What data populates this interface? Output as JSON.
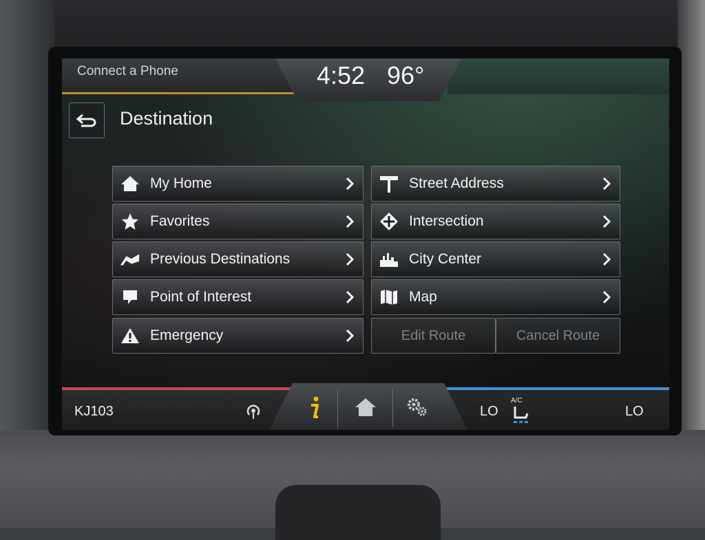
{
  "status": {
    "phone_label": "Connect a Phone",
    "time": "4:52",
    "temperature": "96°"
  },
  "header": {
    "title": "Destination"
  },
  "menu_left": [
    {
      "label": "My Home",
      "icon": "house-icon"
    },
    {
      "label": "Favorites",
      "icon": "star-icon"
    },
    {
      "label": "Previous Destinations",
      "icon": "flag-icon"
    },
    {
      "label": "Point of Interest",
      "icon": "speech-bubble-icon"
    },
    {
      "label": "Emergency",
      "icon": "warning-icon"
    }
  ],
  "menu_right": [
    {
      "label": "Street Address",
      "icon": "street-sign-icon"
    },
    {
      "label": "Intersection",
      "icon": "intersection-icon"
    },
    {
      "label": "City Center",
      "icon": "city-icon"
    },
    {
      "label": "Map",
      "icon": "map-icon"
    }
  ],
  "route_actions": {
    "edit": "Edit Route",
    "cancel": "Cancel Route"
  },
  "bottom_bar": {
    "station": "KJ103",
    "left_climate": "LO",
    "right_climate": "LO",
    "ac_label": "A/C"
  },
  "colors": {
    "accent_amber": "#c98a2e",
    "accent_red": "#c94a55",
    "accent_blue": "#3c93d6",
    "info_yellow": "#f2c200"
  }
}
